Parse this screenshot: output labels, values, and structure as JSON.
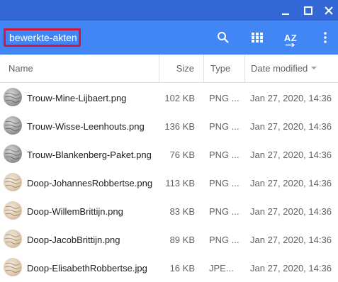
{
  "window": {
    "controls": [
      "minimize-icon",
      "maximize-icon",
      "close-icon"
    ]
  },
  "appbar": {
    "folder_name": "bewerkte-akten",
    "sort_label": "AZ",
    "icons": [
      "search-icon",
      "grid-view-icon",
      "sort-icon",
      "more-vert-icon"
    ]
  },
  "columns": {
    "name": "Name",
    "size": "Size",
    "type": "Type",
    "date": "Date modified"
  },
  "files": [
    {
      "name": "Trouw-Mine-Lijbaert.png",
      "size": "102 KB",
      "type": "PNG ...",
      "date": "Jan 27, 2020, 14:36",
      "thumb": "gray"
    },
    {
      "name": "Trouw-Wisse-Leenhouts.png",
      "size": "136 KB",
      "type": "PNG ...",
      "date": "Jan 27, 2020, 14:36",
      "thumb": "gray"
    },
    {
      "name": "Trouw-Blankenberg-Paket.png",
      "size": "76 KB",
      "type": "PNG ...",
      "date": "Jan 27, 2020, 14:36",
      "thumb": "gray"
    },
    {
      "name": "Doop-JohannesRobbertse.png",
      "size": "113 KB",
      "type": "PNG ...",
      "date": "Jan 27, 2020, 14:36",
      "thumb": "beige"
    },
    {
      "name": "Doop-WillemBrittijn.png",
      "size": "83 KB",
      "type": "PNG ...",
      "date": "Jan 27, 2020, 14:36",
      "thumb": "beige"
    },
    {
      "name": "Doop-JacobBrittijn.png",
      "size": "89 KB",
      "type": "PNG ...",
      "date": "Jan 27, 2020, 14:36",
      "thumb": "beige"
    },
    {
      "name": "Doop-ElisabethRobbertse.jpg",
      "size": "16 KB",
      "type": "JPE...",
      "date": "Jan 27, 2020, 14:36",
      "thumb": "beige"
    }
  ]
}
